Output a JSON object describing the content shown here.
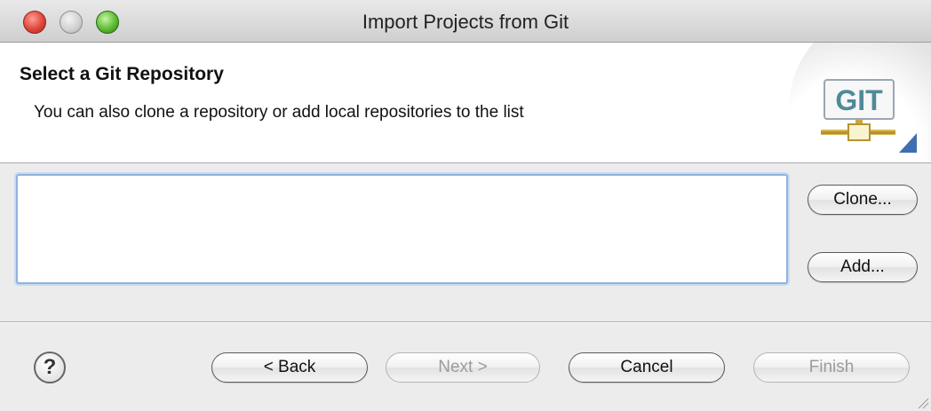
{
  "window": {
    "title": "Import Projects from Git"
  },
  "header": {
    "title": "Select a Git Repository",
    "description": "You can also clone a repository or add local repositories to the list",
    "logo_text": "GIT"
  },
  "side_buttons": {
    "clone": "Clone...",
    "add": "Add..."
  },
  "footer": {
    "help": "?",
    "back": "< Back",
    "next": "Next >",
    "cancel": "Cancel",
    "finish": "Finish"
  }
}
